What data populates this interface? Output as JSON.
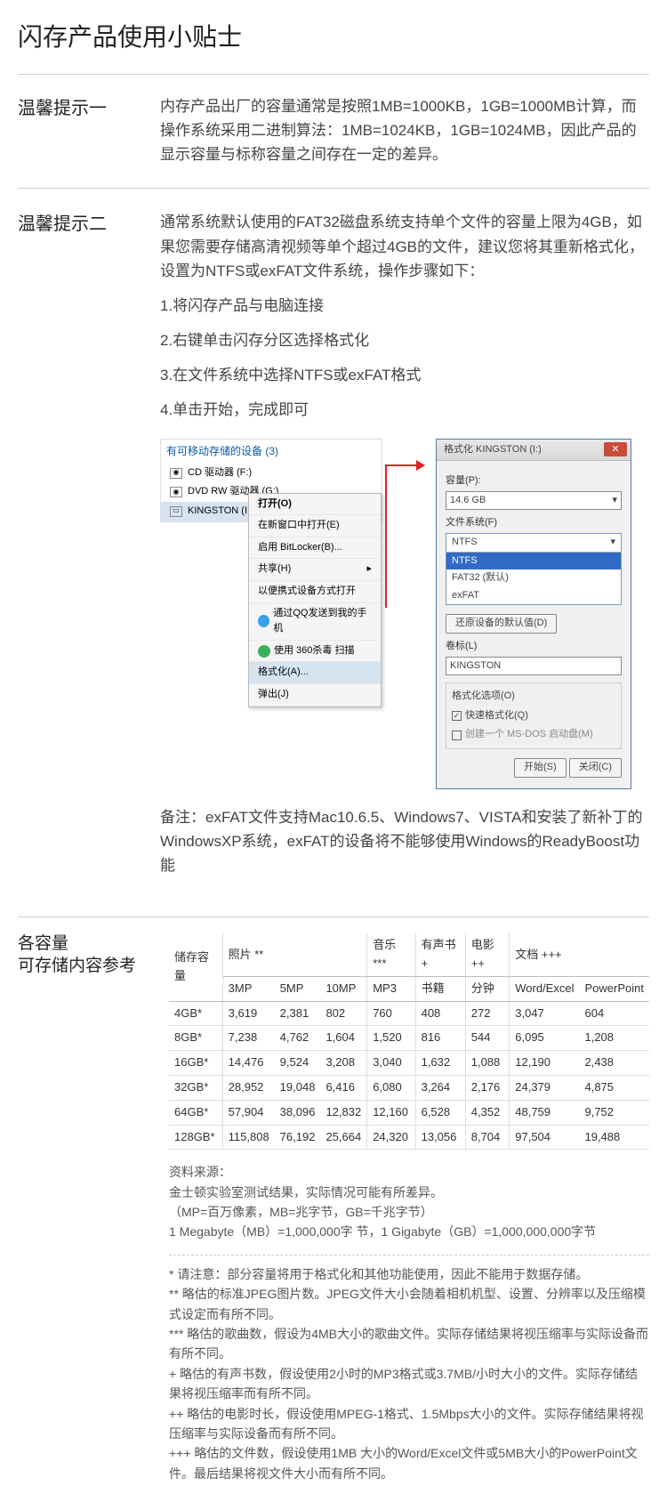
{
  "title": "闪存产品使用小贴士",
  "tip1": {
    "label": "温馨提示一",
    "body": "内存产品出厂的容量通常是按照1MB=1000KB，1GB=1000MB计算，而操作系统采用二进制算法：1MB=1024KB，1GB=1024MB，因此产品的显示容量与标称容量之间存在一定的差异。"
  },
  "tip2": {
    "label": "温馨提示二",
    "intro": "通常系统默认使用的FAT32磁盘系统支持单个文件的容量上限为4GB，如果您需要存储高清视频等单个超过4GB的文件，建议您将其重新格式化，设置为NTFS或exFAT文件系统，操作步骤如下：",
    "steps": [
      "1.将闪存产品与电脑连接",
      "2.右键单击闪存分区选择格式化",
      "3.在文件系统中选择NTFS或exFAT格式",
      "4.单击开始，完成即可"
    ],
    "note": "备注：exFAT文件支持Mac10.6.5、Windows7、VISTA和安装了新补丁的WindowsXP系统，exFAT的设备将不能够使用Windows的ReadyBoost功能"
  },
  "explorer": {
    "header": "有可移动存储的设备 (3)",
    "drives": [
      {
        "label": "CD 驱动器 (F:)"
      },
      {
        "label": "DVD RW 驱动器 (G:)"
      },
      {
        "label": "KINGSTON (I:)",
        "selected": true
      }
    ],
    "menu": [
      "打开(O)",
      "在新窗口中打开(E)",
      "启用 BitLocker(B)...",
      "共享(H)",
      "以便携式设备方式打开",
      "通过QQ发送到我的手机",
      "使用 360杀毒 扫描",
      "格式化(A)...",
      "弹出(J)"
    ],
    "menu_hl_index": 7
  },
  "dialog": {
    "title": "格式化 KINGSTON (I:)",
    "cap_lbl": "容量(P):",
    "cap_val": "14.6 GB",
    "fs_lbl": "文件系统(F)",
    "fs_opts": [
      "NTFS",
      "NTFS",
      "FAT32 (默认)",
      "exFAT"
    ],
    "restore_btn": "还原设备的默认值(D)",
    "vol_lbl": "卷标(L)",
    "vol_val": "KINGSTON",
    "opts_box": "格式化选项(O)",
    "quick_chk": "快速格式化(Q)",
    "msdos_chk": "创建一个 MS-DOS 启动盘(M)",
    "start_btn": "开始(S)",
    "close_btn": "关闭(C)"
  },
  "table": {
    "label1": "各容量",
    "label2": "可存储内容参考",
    "head_top": [
      "储存容量",
      "照片 **",
      "音乐 ***",
      "有声书 +",
      "电影 ++",
      "文档 +++"
    ],
    "head_sub": [
      "",
      "3MP",
      "5MP",
      "10MP",
      "MP3",
      "书籍",
      "分钟",
      "Word/Excel",
      "PowerPoint"
    ],
    "rows": [
      [
        "4GB*",
        "3,619",
        "2,381",
        "802",
        "760",
        "408",
        "272",
        "3,047",
        "604"
      ],
      [
        "8GB*",
        "7,238",
        "4,762",
        "1,604",
        "1,520",
        "816",
        "544",
        "6,095",
        "1,208"
      ],
      [
        "16GB*",
        "14,476",
        "9,524",
        "3,208",
        "3,040",
        "1,632",
        "1,088",
        "12,190",
        "2,438"
      ],
      [
        "32GB*",
        "28,952",
        "19,048",
        "6,416",
        "6,080",
        "3,264",
        "2,176",
        "24,379",
        "4,875"
      ],
      [
        "64GB*",
        "57,904",
        "38,096",
        "12,832",
        "12,160",
        "6,528",
        "4,352",
        "48,759",
        "9,752"
      ],
      [
        "128GB*",
        "115,808",
        "76,192",
        "25,664",
        "24,320",
        "13,056",
        "8,704",
        "97,504",
        "19,488"
      ]
    ]
  },
  "source": {
    "line1": "资料来源：",
    "line2": "金士顿实验室测试结果，实际情况可能有所差异。",
    "line3": "（MP=百万像素，MB=兆字节，GB=千兆字节）",
    "line4": "1 Megabyte（MB）=1,000,000字 节，1 Gigabyte（GB）=1,000,000,000字节"
  },
  "footnotes": {
    "a": "* 请注意：部分容量将用于格式化和其他功能使用，因此不能用于数据存储。",
    "b": "** 略估的标准JPEG图片数。JPEG文件大小会随着相机机型、设置、分辨率以及压缩模式设定而有所不同。",
    "c": "*** 略估的歌曲数，假设为4MB大小的歌曲文件。实际存储结果将视压缩率与实际设备而有所不同。",
    "d": "+ 略估的有声书数，假设使用2小时的MP3格式或3.7MB/小时大小的文件。实际存储结果将视压缩率而有所不同。",
    "e": "++ 略估的电影时长，假设使用MPEG-1格式、1.5Mbps大小的文件。实际存储结果将视压缩率与实际设备而有所不同。",
    "f": "+++ 略估的文件数，假设使用1MB 大小的Word/Excel文件或5MB大小的PowerPoint文件。最后结果将视文件大小而有所不同。"
  }
}
